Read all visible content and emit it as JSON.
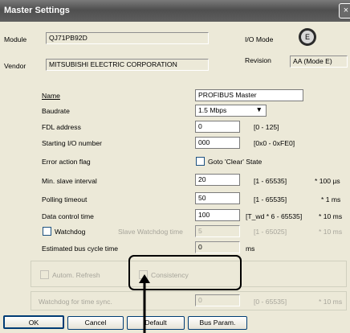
{
  "window": {
    "title": "Master Settings",
    "close": "×"
  },
  "header": {
    "module_label": "Module",
    "module_value": "QJ71PB92D",
    "vendor_label": "Vendor",
    "vendor_value": "MITSUBISHI ELECTRIC CORPORATION",
    "io_mode_label": "I/O Mode",
    "revision_label": "Revision",
    "revision_value": "AA (Mode E)"
  },
  "fields": {
    "name": {
      "label": "Name",
      "value": "PROFIBUS Master"
    },
    "baudrate": {
      "label": "Baudrate",
      "value": "1.5 Mbps"
    },
    "fdl": {
      "label": "FDL address",
      "value": "0",
      "range": "[0 - 125]"
    },
    "start_io": {
      "label": "Starting I/O number",
      "value": "000",
      "range": "[0x0 - 0xFE0]"
    },
    "error_flag": {
      "label": "Error action flag",
      "check_label": "Goto 'Clear' State"
    },
    "min_slave": {
      "label": "Min. slave interval",
      "value": "20",
      "range": "[1 - 65535]",
      "unit": "* 100 µs"
    },
    "polling": {
      "label": "Polling timeout",
      "value": "50",
      "range": "[1 - 65535]",
      "unit": "* 1 ms"
    },
    "dct": {
      "label": "Data control time",
      "value": "100",
      "range": "[T_wd * 6 - 65535]",
      "unit": "* 10 ms"
    },
    "watchdog": {
      "label": "Watchdog",
      "sub_label": "Slave Watchdog time",
      "value": "5",
      "range": "[1 - 65025]",
      "unit": "* 10 ms"
    },
    "cycle": {
      "label": "Estimated bus cycle time",
      "value": "0",
      "unit": "ms"
    }
  },
  "options": {
    "autom_refresh": "Autom. Refresh",
    "consistency": "Consistency",
    "watchdog_sync_label": "Watchdog for time sync.",
    "watchdog_sync_value": "0",
    "watchdog_sync_range": "[0 - 65535]",
    "watchdog_sync_unit": "* 10 ms"
  },
  "buttons": {
    "ok": "OK",
    "cancel": "Cancel",
    "default": "Default",
    "bus_param": "Bus Param."
  }
}
